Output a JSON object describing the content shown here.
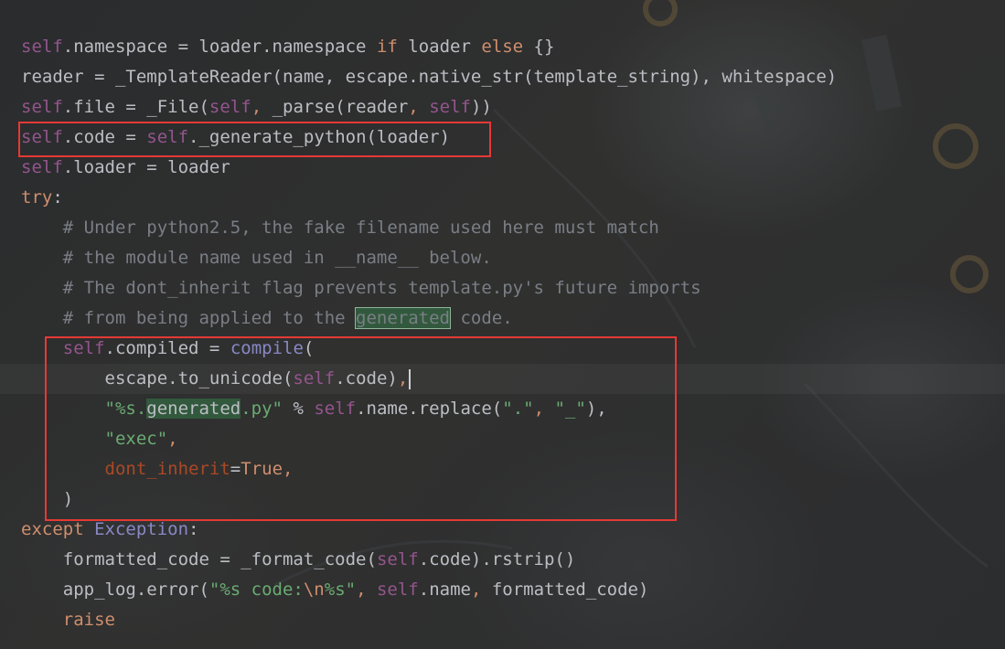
{
  "editor": {
    "lines": [
      {
        "id": "l1",
        "segments": [
          [
            "self",
            "self"
          ],
          [
            "",
            ".namespace = loader.namespace "
          ],
          [
            "kw",
            "if"
          ],
          [
            "",
            " loader "
          ],
          [
            "kw",
            "else"
          ],
          [
            "",
            " {}"
          ]
        ]
      },
      {
        "id": "l2",
        "segments": [
          [
            "",
            "reader = _TemplateReader(name, escape.native_str(template_string), whitespace)"
          ]
        ]
      },
      {
        "id": "l3",
        "segments": [
          [
            "self",
            "self"
          ],
          [
            "",
            ".file = _File("
          ],
          [
            "self",
            "self"
          ],
          [
            "kw",
            ","
          ],
          [
            "",
            " _parse(reader"
          ],
          [
            "kw",
            ","
          ],
          [
            "",
            " "
          ],
          [
            "self",
            "self"
          ],
          [
            "",
            "))"
          ]
        ]
      },
      {
        "id": "l4",
        "segments": [
          [
            "self",
            "self"
          ],
          [
            "",
            ".code = "
          ],
          [
            "self",
            "self"
          ],
          [
            "",
            "._generate_python(loader)"
          ]
        ]
      },
      {
        "id": "l5",
        "segments": [
          [
            "self",
            "self"
          ],
          [
            "",
            ".loader = loader"
          ]
        ]
      },
      {
        "id": "l6",
        "segments": [
          [
            "kw",
            "try"
          ],
          [
            "",
            ":"
          ]
        ]
      },
      {
        "id": "l7",
        "segments": [
          [
            "cm",
            "    # Under python2.5, the fake filename used here must match"
          ]
        ]
      },
      {
        "id": "l8",
        "segments": [
          [
            "cm",
            "    # the module name used in __name__ below."
          ]
        ]
      },
      {
        "id": "l9",
        "segments": [
          [
            "cm",
            "    # The dont_inherit flag prevents template.py's future imports"
          ]
        ]
      },
      {
        "id": "l10",
        "segments": [
          [
            "cm",
            "    # from being applied to the "
          ],
          [
            "cmhl",
            "generated"
          ],
          [
            "cm",
            " code."
          ]
        ]
      },
      {
        "id": "l11",
        "segments": [
          [
            "",
            "    "
          ],
          [
            "self",
            "self"
          ],
          [
            "",
            ".compiled = "
          ],
          [
            "cls",
            "compile"
          ],
          [
            "",
            "("
          ]
        ]
      },
      {
        "id": "l12",
        "segments": [
          [
            "",
            "        escape.to_unicode("
          ],
          [
            "self",
            "self"
          ],
          [
            "",
            ".code)"
          ],
          [
            "kw",
            ","
          ],
          [
            "caret",
            ""
          ]
        ]
      },
      {
        "id": "l13",
        "segments": [
          [
            "",
            "        "
          ],
          [
            "str",
            "\"%s."
          ],
          [
            "strhl",
            "generated"
          ],
          [
            "str",
            ".py\""
          ],
          [
            "",
            " % "
          ],
          [
            "self",
            "self"
          ],
          [
            "",
            ".name.replace("
          ],
          [
            "str",
            "\".\""
          ],
          [
            "kw",
            ","
          ],
          [
            "",
            " "
          ],
          [
            "str",
            "\"_\""
          ],
          [
            "",
            "),"
          ]
        ]
      },
      {
        "id": "l14",
        "segments": [
          [
            "",
            "        "
          ],
          [
            "str",
            "\"exec\""
          ],
          [
            "kw",
            ","
          ]
        ]
      },
      {
        "id": "l15",
        "segments": [
          [
            "",
            "        "
          ],
          [
            "param",
            "dont_inherit"
          ],
          [
            "",
            "="
          ],
          [
            "kw",
            "True"
          ],
          [
            "kw",
            ","
          ]
        ]
      },
      {
        "id": "l16",
        "segments": [
          [
            "",
            "    )"
          ]
        ]
      },
      {
        "id": "l17",
        "segments": [
          [
            "kw",
            "except"
          ],
          [
            "",
            " "
          ],
          [
            "cls",
            "Exception"
          ],
          [
            "",
            ":"
          ]
        ]
      },
      {
        "id": "l18",
        "segments": [
          [
            "",
            "    formatted_code = _format_code("
          ],
          [
            "self",
            "self"
          ],
          [
            "",
            ".code).rstrip()"
          ]
        ]
      },
      {
        "id": "l19",
        "segments": [
          [
            "",
            "    app_log.error("
          ],
          [
            "str",
            "\"%s code:"
          ],
          [
            "esc",
            "\\n"
          ],
          [
            "str",
            "%s\""
          ],
          [
            "kw",
            ","
          ],
          [
            "",
            " "
          ],
          [
            "self",
            "self"
          ],
          [
            "",
            ".name"
          ],
          [
            "kw",
            ","
          ],
          [
            "",
            " formatted_code)"
          ]
        ]
      },
      {
        "id": "l20",
        "segments": [
          [
            "",
            "    "
          ],
          [
            "kw",
            "raise"
          ]
        ]
      }
    ]
  },
  "colors": {
    "background": "#2b2b2b",
    "keyword": "#cf8e6d",
    "self": "#94558d",
    "string": "#6aab73",
    "comment": "#7a7e85",
    "highlight": "#32593d",
    "annotation_box": "#e53935"
  }
}
